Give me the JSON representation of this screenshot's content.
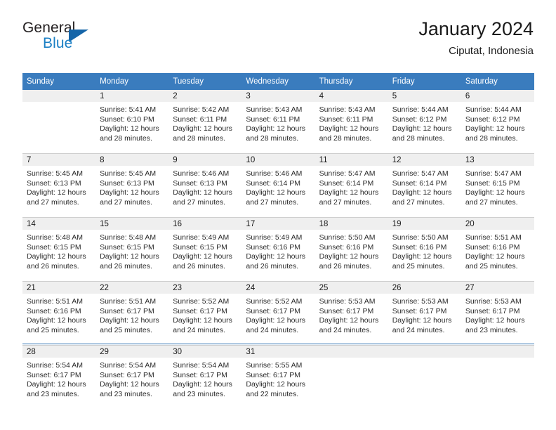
{
  "brand": {
    "name_part1": "General",
    "name_part2": "Blue",
    "triangle_icon": "triangle-icon"
  },
  "header": {
    "title": "January 2024",
    "location": "Ciputat, Indonesia"
  },
  "calendar": {
    "weekday_headers": [
      "Sunday",
      "Monday",
      "Tuesday",
      "Wednesday",
      "Thursday",
      "Friday",
      "Saturday"
    ],
    "header_bg": "#3a7cbe",
    "daynum_bg": "#efefef",
    "rule_color": "#2a6fb0",
    "weeks": [
      [
        {
          "day": "",
          "sunrise": "",
          "sunset": "",
          "daylight_line1": "",
          "daylight_line2": ""
        },
        {
          "day": "1",
          "sunrise": "Sunrise: 5:41 AM",
          "sunset": "Sunset: 6:10 PM",
          "daylight_line1": "Daylight: 12 hours",
          "daylight_line2": "and 28 minutes."
        },
        {
          "day": "2",
          "sunrise": "Sunrise: 5:42 AM",
          "sunset": "Sunset: 6:11 PM",
          "daylight_line1": "Daylight: 12 hours",
          "daylight_line2": "and 28 minutes."
        },
        {
          "day": "3",
          "sunrise": "Sunrise: 5:43 AM",
          "sunset": "Sunset: 6:11 PM",
          "daylight_line1": "Daylight: 12 hours",
          "daylight_line2": "and 28 minutes."
        },
        {
          "day": "4",
          "sunrise": "Sunrise: 5:43 AM",
          "sunset": "Sunset: 6:11 PM",
          "daylight_line1": "Daylight: 12 hours",
          "daylight_line2": "and 28 minutes."
        },
        {
          "day": "5",
          "sunrise": "Sunrise: 5:44 AM",
          "sunset": "Sunset: 6:12 PM",
          "daylight_line1": "Daylight: 12 hours",
          "daylight_line2": "and 28 minutes."
        },
        {
          "day": "6",
          "sunrise": "Sunrise: 5:44 AM",
          "sunset": "Sunset: 6:12 PM",
          "daylight_line1": "Daylight: 12 hours",
          "daylight_line2": "and 28 minutes."
        }
      ],
      [
        {
          "day": "7",
          "sunrise": "Sunrise: 5:45 AM",
          "sunset": "Sunset: 6:13 PM",
          "daylight_line1": "Daylight: 12 hours",
          "daylight_line2": "and 27 minutes."
        },
        {
          "day": "8",
          "sunrise": "Sunrise: 5:45 AM",
          "sunset": "Sunset: 6:13 PM",
          "daylight_line1": "Daylight: 12 hours",
          "daylight_line2": "and 27 minutes."
        },
        {
          "day": "9",
          "sunrise": "Sunrise: 5:46 AM",
          "sunset": "Sunset: 6:13 PM",
          "daylight_line1": "Daylight: 12 hours",
          "daylight_line2": "and 27 minutes."
        },
        {
          "day": "10",
          "sunrise": "Sunrise: 5:46 AM",
          "sunset": "Sunset: 6:14 PM",
          "daylight_line1": "Daylight: 12 hours",
          "daylight_line2": "and 27 minutes."
        },
        {
          "day": "11",
          "sunrise": "Sunrise: 5:47 AM",
          "sunset": "Sunset: 6:14 PM",
          "daylight_line1": "Daylight: 12 hours",
          "daylight_line2": "and 27 minutes."
        },
        {
          "day": "12",
          "sunrise": "Sunrise: 5:47 AM",
          "sunset": "Sunset: 6:14 PM",
          "daylight_line1": "Daylight: 12 hours",
          "daylight_line2": "and 27 minutes."
        },
        {
          "day": "13",
          "sunrise": "Sunrise: 5:47 AM",
          "sunset": "Sunset: 6:15 PM",
          "daylight_line1": "Daylight: 12 hours",
          "daylight_line2": "and 27 minutes."
        }
      ],
      [
        {
          "day": "14",
          "sunrise": "Sunrise: 5:48 AM",
          "sunset": "Sunset: 6:15 PM",
          "daylight_line1": "Daylight: 12 hours",
          "daylight_line2": "and 26 minutes."
        },
        {
          "day": "15",
          "sunrise": "Sunrise: 5:48 AM",
          "sunset": "Sunset: 6:15 PM",
          "daylight_line1": "Daylight: 12 hours",
          "daylight_line2": "and 26 minutes."
        },
        {
          "day": "16",
          "sunrise": "Sunrise: 5:49 AM",
          "sunset": "Sunset: 6:15 PM",
          "daylight_line1": "Daylight: 12 hours",
          "daylight_line2": "and 26 minutes."
        },
        {
          "day": "17",
          "sunrise": "Sunrise: 5:49 AM",
          "sunset": "Sunset: 6:16 PM",
          "daylight_line1": "Daylight: 12 hours",
          "daylight_line2": "and 26 minutes."
        },
        {
          "day": "18",
          "sunrise": "Sunrise: 5:50 AM",
          "sunset": "Sunset: 6:16 PM",
          "daylight_line1": "Daylight: 12 hours",
          "daylight_line2": "and 26 minutes."
        },
        {
          "day": "19",
          "sunrise": "Sunrise: 5:50 AM",
          "sunset": "Sunset: 6:16 PM",
          "daylight_line1": "Daylight: 12 hours",
          "daylight_line2": "and 25 minutes."
        },
        {
          "day": "20",
          "sunrise": "Sunrise: 5:51 AM",
          "sunset": "Sunset: 6:16 PM",
          "daylight_line1": "Daylight: 12 hours",
          "daylight_line2": "and 25 minutes."
        }
      ],
      [
        {
          "day": "21",
          "sunrise": "Sunrise: 5:51 AM",
          "sunset": "Sunset: 6:16 PM",
          "daylight_line1": "Daylight: 12 hours",
          "daylight_line2": "and 25 minutes."
        },
        {
          "day": "22",
          "sunrise": "Sunrise: 5:51 AM",
          "sunset": "Sunset: 6:17 PM",
          "daylight_line1": "Daylight: 12 hours",
          "daylight_line2": "and 25 minutes."
        },
        {
          "day": "23",
          "sunrise": "Sunrise: 5:52 AM",
          "sunset": "Sunset: 6:17 PM",
          "daylight_line1": "Daylight: 12 hours",
          "daylight_line2": "and 24 minutes."
        },
        {
          "day": "24",
          "sunrise": "Sunrise: 5:52 AM",
          "sunset": "Sunset: 6:17 PM",
          "daylight_line1": "Daylight: 12 hours",
          "daylight_line2": "and 24 minutes."
        },
        {
          "day": "25",
          "sunrise": "Sunrise: 5:53 AM",
          "sunset": "Sunset: 6:17 PM",
          "daylight_line1": "Daylight: 12 hours",
          "daylight_line2": "and 24 minutes."
        },
        {
          "day": "26",
          "sunrise": "Sunrise: 5:53 AM",
          "sunset": "Sunset: 6:17 PM",
          "daylight_line1": "Daylight: 12 hours",
          "daylight_line2": "and 24 minutes."
        },
        {
          "day": "27",
          "sunrise": "Sunrise: 5:53 AM",
          "sunset": "Sunset: 6:17 PM",
          "daylight_line1": "Daylight: 12 hours",
          "daylight_line2": "and 23 minutes."
        }
      ],
      [
        {
          "day": "28",
          "sunrise": "Sunrise: 5:54 AM",
          "sunset": "Sunset: 6:17 PM",
          "daylight_line1": "Daylight: 12 hours",
          "daylight_line2": "and 23 minutes."
        },
        {
          "day": "29",
          "sunrise": "Sunrise: 5:54 AM",
          "sunset": "Sunset: 6:17 PM",
          "daylight_line1": "Daylight: 12 hours",
          "daylight_line2": "and 23 minutes."
        },
        {
          "day": "30",
          "sunrise": "Sunrise: 5:54 AM",
          "sunset": "Sunset: 6:17 PM",
          "daylight_line1": "Daylight: 12 hours",
          "daylight_line2": "and 23 minutes."
        },
        {
          "day": "31",
          "sunrise": "Sunrise: 5:55 AM",
          "sunset": "Sunset: 6:17 PM",
          "daylight_line1": "Daylight: 12 hours",
          "daylight_line2": "and 22 minutes."
        },
        {
          "day": "",
          "sunrise": "",
          "sunset": "",
          "daylight_line1": "",
          "daylight_line2": ""
        },
        {
          "day": "",
          "sunrise": "",
          "sunset": "",
          "daylight_line1": "",
          "daylight_line2": ""
        },
        {
          "day": "",
          "sunrise": "",
          "sunset": "",
          "daylight_line1": "",
          "daylight_line2": ""
        }
      ]
    ]
  }
}
